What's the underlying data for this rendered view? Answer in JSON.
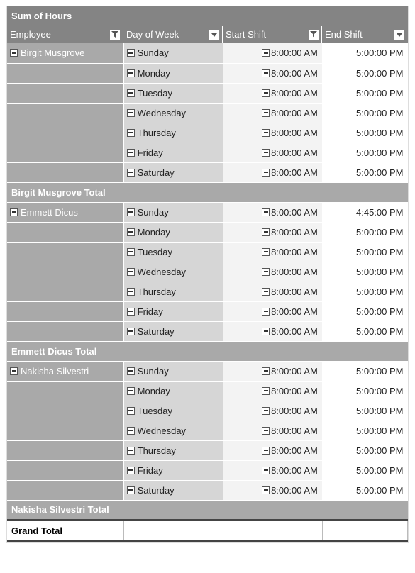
{
  "title": "Sum of Hours",
  "columns": {
    "employee": "Employee",
    "dayOfWeek": "Day of Week",
    "startShift": "Start Shift",
    "endShift": "End Shift"
  },
  "grandTotalLabel": "Grand Total",
  "groups": [
    {
      "name": "Birgit Musgrove",
      "totalLabel": "Birgit Musgrove Total",
      "rows": [
        {
          "day": "Sunday",
          "start": "8:00:00 AM",
          "end": "5:00:00 PM"
        },
        {
          "day": "Monday",
          "start": "8:00:00 AM",
          "end": "5:00:00 PM"
        },
        {
          "day": "Tuesday",
          "start": "8:00:00 AM",
          "end": "5:00:00 PM"
        },
        {
          "day": "Wednesday",
          "start": "8:00:00 AM",
          "end": "5:00:00 PM"
        },
        {
          "day": "Thursday",
          "start": "8:00:00 AM",
          "end": "5:00:00 PM"
        },
        {
          "day": "Friday",
          "start": "8:00:00 AM",
          "end": "5:00:00 PM"
        },
        {
          "day": "Saturday",
          "start": "8:00:00 AM",
          "end": "5:00:00 PM"
        }
      ]
    },
    {
      "name": "Emmett Dicus",
      "totalLabel": "Emmett Dicus Total",
      "rows": [
        {
          "day": "Sunday",
          "start": "8:00:00 AM",
          "end": "4:45:00 PM"
        },
        {
          "day": "Monday",
          "start": "8:00:00 AM",
          "end": "5:00:00 PM"
        },
        {
          "day": "Tuesday",
          "start": "8:00:00 AM",
          "end": "5:00:00 PM"
        },
        {
          "day": "Wednesday",
          "start": "8:00:00 AM",
          "end": "5:00:00 PM"
        },
        {
          "day": "Thursday",
          "start": "8:00:00 AM",
          "end": "5:00:00 PM"
        },
        {
          "day": "Friday",
          "start": "8:00:00 AM",
          "end": "5:00:00 PM"
        },
        {
          "day": "Saturday",
          "start": "8:00:00 AM",
          "end": "5:00:00 PM"
        }
      ]
    },
    {
      "name": "Nakisha Silvestri",
      "totalLabel": "Nakisha Silvestri Total",
      "rows": [
        {
          "day": "Sunday",
          "start": "8:00:00 AM",
          "end": "5:00:00 PM"
        },
        {
          "day": "Monday",
          "start": "8:00:00 AM",
          "end": "5:00:00 PM"
        },
        {
          "day": "Tuesday",
          "start": "8:00:00 AM",
          "end": "5:00:00 PM"
        },
        {
          "day": "Wednesday",
          "start": "8:00:00 AM",
          "end": "5:00:00 PM"
        },
        {
          "day": "Thursday",
          "start": "8:00:00 AM",
          "end": "5:00:00 PM"
        },
        {
          "day": "Friday",
          "start": "8:00:00 AM",
          "end": "5:00:00 PM"
        },
        {
          "day": "Saturday",
          "start": "8:00:00 AM",
          "end": "5:00:00 PM"
        }
      ]
    }
  ]
}
